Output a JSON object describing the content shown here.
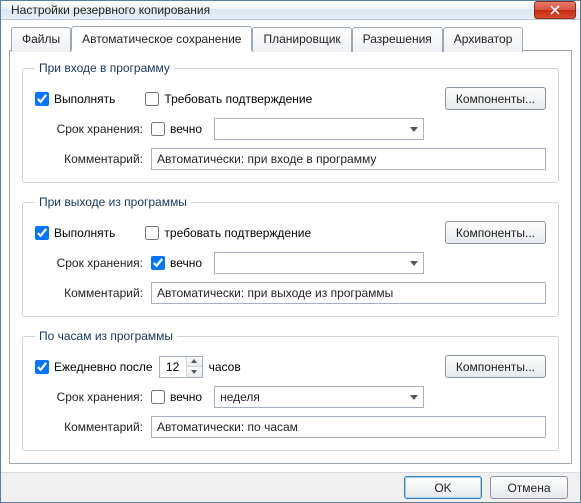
{
  "window": {
    "title": "Настройки резервного копирования"
  },
  "tabs": {
    "files": "Файлы",
    "autosave": "Автоматическое сохранение",
    "scheduler": "Планировщик",
    "permissions": "Разрешения",
    "archiver": "Архиватор"
  },
  "group_login": {
    "legend": "При входе в программу",
    "execute": "Выполнять",
    "require_confirm": "Требовать подтверждение",
    "components_btn": "Компоненты...",
    "retention_label": "Срок хранения:",
    "forever": "вечно",
    "retention_value": "",
    "comment_label": "Комментарий:",
    "comment_value": "Автоматически: при входе в программу"
  },
  "group_logout": {
    "legend": "При выходе из программы",
    "execute": "Выполнять",
    "require_confirm": "требовать подтверждение",
    "components_btn": "Компоненты...",
    "retention_label": "Срок хранения:",
    "forever": "вечно",
    "retention_value": "",
    "comment_label": "Комментарий:",
    "comment_value": "Автоматически: при выходе из программы"
  },
  "group_clock": {
    "legend": "По часам из программы",
    "daily_after": "Ежедневно после",
    "hours_value": "12",
    "hours_unit": "часов",
    "components_btn": "Компоненты...",
    "retention_label": "Срок хранения:",
    "forever": "вечно",
    "retention_value": "неделя",
    "comment_label": "Комментарий:",
    "comment_value": "Автоматически: по часам"
  },
  "footer": {
    "ok": "OK",
    "cancel": "Отмена"
  }
}
